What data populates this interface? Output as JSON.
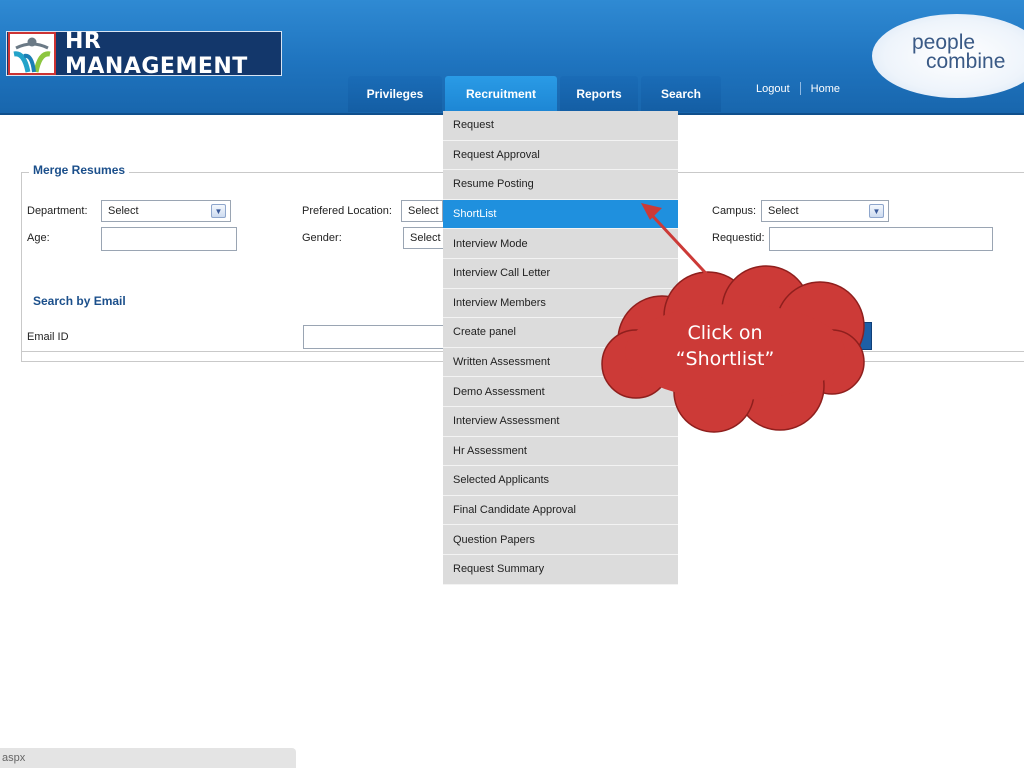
{
  "header": {
    "app_title": "HR MANAGEMENT",
    "brand_line1": "people",
    "brand_line2": "combine"
  },
  "nav": {
    "tabs": [
      {
        "label": "Privileges"
      },
      {
        "label": "Recruitment"
      },
      {
        "label": "Reports"
      },
      {
        "label": "Search"
      }
    ],
    "active_tab": "Recruitment",
    "links": [
      {
        "label": "Logout"
      },
      {
        "label": "Home"
      }
    ]
  },
  "merge": {
    "legend": "Merge Resumes",
    "department_label": "Department:",
    "department_value": "Select",
    "location_label": "Prefered Location:",
    "location_value": "Select",
    "campus_label": "Campus:",
    "campus_value": "Select",
    "age_label": "Age:",
    "gender_label": "Gender:",
    "gender_value": "Select",
    "requestid_label": "Requestid:"
  },
  "email": {
    "legend": "Search by Email",
    "email_label": "Email ID"
  },
  "dropdown": {
    "items": [
      "Request",
      "Request Approval",
      "Resume Posting",
      "ShortList",
      "Interview Mode",
      "Interview Call Letter",
      "Interview Members",
      "Create panel",
      "Written Assessment",
      "Demo Assessment",
      "Interview Assessment",
      "Hr Assessment",
      "Selected Applicants",
      "Final Candidate Approval",
      "Question Papers",
      "Request Summary"
    ],
    "active_item": "ShortList"
  },
  "callout": {
    "line1": "Click on",
    "line2": "“Shortlist”",
    "color": "#cc3a37"
  },
  "status_bar": {
    "text": "aspx"
  }
}
